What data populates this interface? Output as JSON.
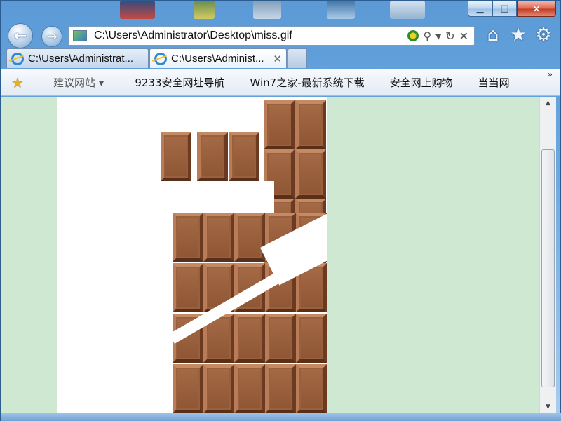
{
  "window": {
    "caption_buttons": [
      {
        "name": "minimize",
        "glyph": "▁"
      },
      {
        "name": "maximize",
        "glyph": "□"
      },
      {
        "name": "close",
        "glyph": "✕"
      }
    ],
    "close_color": "#c23d22",
    "frame_color": "#6aa8e0"
  },
  "nav": {
    "back_icon": "←",
    "forward_icon": "→",
    "address": "C:\\Users\\Administrator\\Desktop\\miss.gif",
    "search_icon": "⚲",
    "dropdown_icon": "▾",
    "refresh_icon": "↻",
    "stop_icon": "✕",
    "home_icon": "⌂",
    "favorites_icon": "★",
    "tools_icon": "⚙"
  },
  "tabs": [
    {
      "label": "C:\\Users\\Administrat...",
      "active": false
    },
    {
      "label": "C:\\Users\\Administ...",
      "active": true,
      "close": "✕"
    }
  ],
  "favorites_bar": {
    "star_icon": "★",
    "items": [
      {
        "label": "建议网站 ▾"
      },
      {
        "label": "9233安全网址导航"
      },
      {
        "label": "Win7之家-最新系统下载"
      },
      {
        "label": "安全网上购物"
      },
      {
        "label": "当当网"
      }
    ],
    "overflow": "»"
  },
  "content": {
    "background_color": "#cfe8d1",
    "image_background": "#ffffff",
    "chocolate_color": "#8e5634"
  },
  "scrollbar": {
    "up_arrow": "▲",
    "down_arrow": "▼",
    "grip": "≡"
  }
}
